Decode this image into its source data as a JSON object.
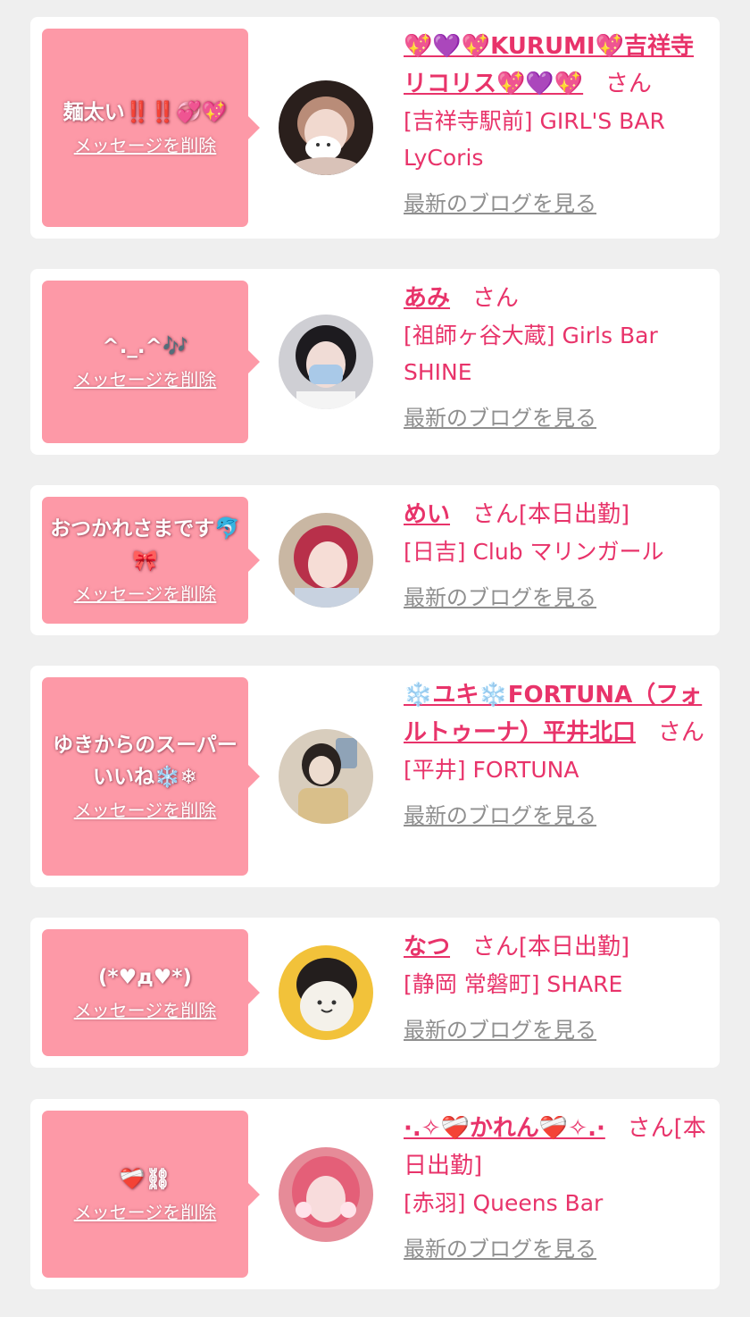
{
  "delete_label": "メッセージを削除",
  "blog_label": "最新のブログを見る",
  "san_label": "さん",
  "colors": {
    "accent": "#e8336a",
    "bubble": "#fd99a7",
    "link_gray": "#8f8f8f",
    "background": "#efefef"
  },
  "cards": [
    {
      "message": "麺太い‼️‼️💞💖",
      "name": "💖💜💖KURUMI💖吉祥寺リコリス💖💜💖",
      "status": "",
      "shop": "[吉祥寺駅前] GIRL'S BAR LyCoris",
      "avatar": "avatar-photo"
    },
    {
      "message": "^._.^🎶",
      "name": "あみ",
      "status": "",
      "shop": "[祖師ヶ谷大蔵] Girls Bar SHINE",
      "avatar": "avatar-photo"
    },
    {
      "message": "おつかれさまです🐬🎀",
      "name": "めい",
      "status": "[本日出勤]",
      "shop": "[日吉] Club マリンガール",
      "avatar": "avatar-photo"
    },
    {
      "message": "ゆきからのスーパーいいね❄️❄",
      "name": "❄️ユキ❄️FORTUNA（フォルトゥーナ）平井北口",
      "status": "",
      "shop": "[平井] FORTUNA",
      "avatar": "avatar-photo"
    },
    {
      "message": "(*♥д♥*)",
      "name": "なつ",
      "status": "[本日出勤]",
      "shop": "[静岡 常磐町] SHARE",
      "avatar": "avatar-photo"
    },
    {
      "message": "❤️‍🩹⛓",
      "name": "·.✧❤️‍🩹かれん❤️‍🩹✧.·",
      "status": "[本日出勤]",
      "shop": "[赤羽] Queens Bar",
      "avatar": "avatar-photo"
    }
  ]
}
